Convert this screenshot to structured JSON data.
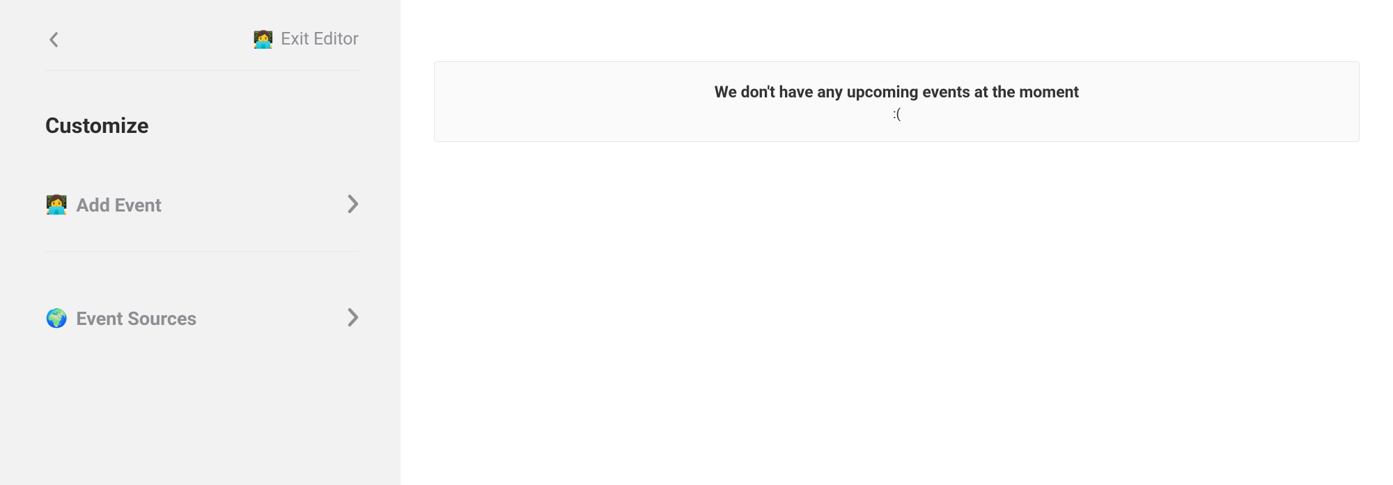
{
  "sidebar": {
    "exit_icon": "👩‍💻",
    "exit_label": "Exit Editor",
    "section_title": "Customize",
    "items": [
      {
        "icon": "👩‍💻",
        "label": "Add Event"
      },
      {
        "icon": "🌍",
        "label": "Event Sources"
      }
    ]
  },
  "main": {
    "empty_heading": "We don't have any upcoming events at the moment",
    "empty_sub": ":("
  }
}
